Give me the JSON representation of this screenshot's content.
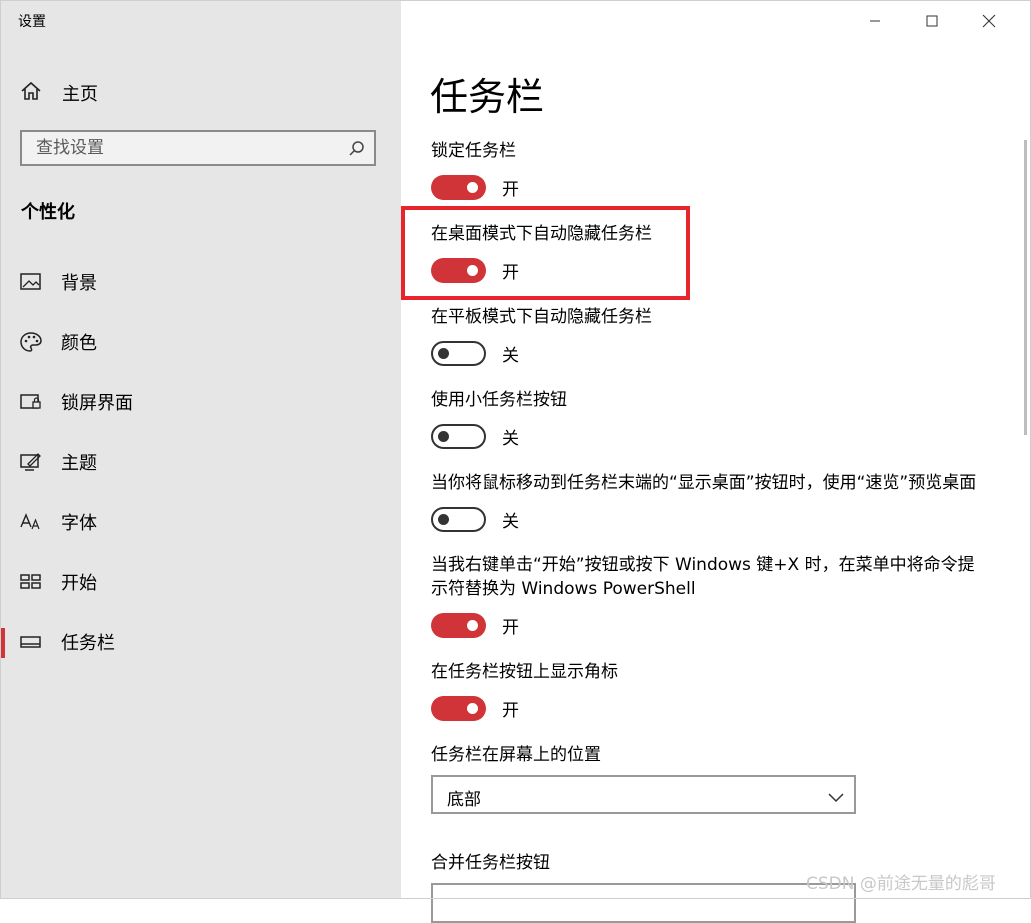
{
  "window": {
    "title": "设置"
  },
  "sidebar": {
    "home_label": "主页",
    "search_placeholder": "查找设置",
    "section": "个性化",
    "items": [
      {
        "label": "背景",
        "icon": "picture-icon"
      },
      {
        "label": "颜色",
        "icon": "palette-icon"
      },
      {
        "label": "锁屏界面",
        "icon": "lock-screen-icon"
      },
      {
        "label": "主题",
        "icon": "theme-icon"
      },
      {
        "label": "字体",
        "icon": "font-icon"
      },
      {
        "label": "开始",
        "icon": "start-icon"
      },
      {
        "label": "任务栏",
        "icon": "taskbar-icon",
        "selected": true
      }
    ]
  },
  "main": {
    "title": "任务栏",
    "settings": [
      {
        "label": "锁定任务栏",
        "state": "开",
        "on": true
      },
      {
        "label": "在桌面模式下自动隐藏任务栏",
        "state": "开",
        "on": true
      },
      {
        "label": "在平板模式下自动隐藏任务栏",
        "state": "关",
        "on": false
      },
      {
        "label": "使用小任务栏按钮",
        "state": "关",
        "on": false
      },
      {
        "label": "当你将鼠标移动到任务栏末端的“显示桌面”按钮时，使用“速览”预览桌面",
        "state": "关",
        "on": false
      },
      {
        "label": "当我右键单击“开始”按钮或按下 Windows 键+X 时，在菜单中将命令提示符替换为 Windows PowerShell",
        "state": "开",
        "on": true
      },
      {
        "label": "在任务栏按钮上显示角标",
        "state": "开",
        "on": true
      }
    ],
    "position_label": "任务栏在屏幕上的位置",
    "position_value": "底部",
    "combine_label": "合并任务栏按钮"
  },
  "watermark": "CSDN @前途无量的彪哥",
  "colors": {
    "accent": "#d13438",
    "highlight_box": "#e8242c",
    "sidebar_bg": "#e6e6e6"
  }
}
